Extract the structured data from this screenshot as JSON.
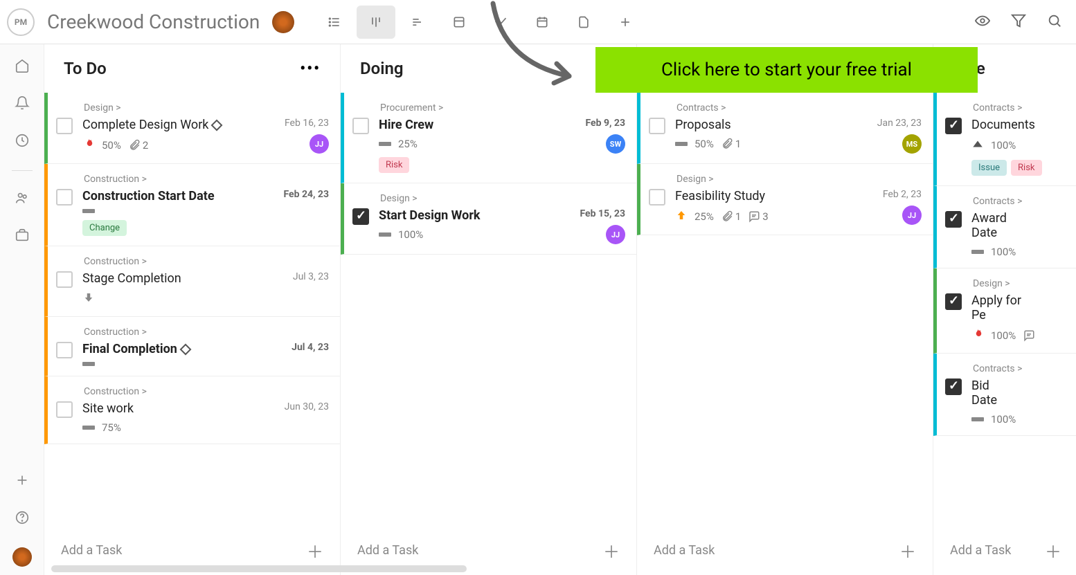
{
  "logo_text": "PM",
  "project": "Creekwood Construction",
  "cta": "Click here to start your free trial",
  "add_task_label": "Add a Task",
  "columns": [
    {
      "title": "To Do",
      "show_menu": true,
      "cards": [
        {
          "breadcrumb": "Design >",
          "title": "Complete Design Work",
          "bold": false,
          "milestone": true,
          "date": "Feb 16, 23",
          "date_bold": false,
          "color": "green",
          "checked": false,
          "meta": [
            {
              "type": "flame"
            },
            {
              "type": "text",
              "val": "50%"
            },
            {
              "type": "attach",
              "val": "2"
            }
          ],
          "tags": [],
          "assignee": {
            "cls": "jj",
            "txt": "JJ"
          }
        },
        {
          "breadcrumb": "Construction >",
          "title": "Construction Start Date",
          "bold": true,
          "milestone": false,
          "date": "Feb 24, 23",
          "date_bold": true,
          "color": "orange",
          "checked": false,
          "meta": [
            {
              "type": "bar"
            }
          ],
          "tags": [
            "change"
          ],
          "assignee": null
        },
        {
          "breadcrumb": "Construction >",
          "title": "Stage Completion",
          "bold": false,
          "milestone": false,
          "date": "Jul 3, 23",
          "date_bold": false,
          "color": "orange",
          "checked": false,
          "meta": [
            {
              "type": "arrow-down"
            }
          ],
          "tags": [],
          "assignee": null
        },
        {
          "breadcrumb": "Construction >",
          "title": "Final Completion",
          "bold": true,
          "milestone": true,
          "date": "Jul 4, 23",
          "date_bold": true,
          "color": "orange",
          "checked": false,
          "meta": [
            {
              "type": "bar"
            }
          ],
          "tags": [],
          "assignee": null
        },
        {
          "breadcrumb": "Construction >",
          "title": "Site work",
          "bold": false,
          "milestone": false,
          "date": "Jun 30, 23",
          "date_bold": false,
          "color": "orange",
          "checked": false,
          "meta": [
            {
              "type": "bar"
            },
            {
              "type": "text",
              "val": "75%"
            }
          ],
          "tags": [],
          "assignee": null
        }
      ]
    },
    {
      "title": "Doing",
      "show_menu": false,
      "cards": [
        {
          "breadcrumb": "Procurement >",
          "title": "Hire Crew",
          "bold": true,
          "milestone": false,
          "date": "Feb 9, 23",
          "date_bold": true,
          "color": "cyan",
          "checked": false,
          "meta": [
            {
              "type": "bar"
            },
            {
              "type": "text",
              "val": "25%"
            }
          ],
          "tags": [
            "risk"
          ],
          "assignee": {
            "cls": "sw",
            "txt": "SW"
          }
        },
        {
          "breadcrumb": "Design >",
          "title": "Start Design Work",
          "bold": true,
          "milestone": false,
          "date": "Feb 15, 23",
          "date_bold": true,
          "color": "green",
          "checked": true,
          "meta": [
            {
              "type": "bar"
            },
            {
              "type": "text",
              "val": "100%"
            }
          ],
          "tags": [],
          "assignee": {
            "cls": "jj",
            "txt": "JJ"
          }
        }
      ]
    },
    {
      "title": "",
      "show_menu": false,
      "cards": [
        {
          "breadcrumb": "Contracts >",
          "title": "Proposals",
          "bold": false,
          "milestone": false,
          "date": "Jan 23, 23",
          "date_bold": false,
          "color": "cyan",
          "checked": false,
          "meta": [
            {
              "type": "bar"
            },
            {
              "type": "text",
              "val": "50%"
            },
            {
              "type": "attach",
              "val": "1"
            }
          ],
          "tags": [],
          "assignee": {
            "cls": "ms",
            "txt": "MS"
          }
        },
        {
          "breadcrumb": "Design >",
          "title": "Feasibility Study",
          "bold": false,
          "milestone": false,
          "date": "Feb 2, 23",
          "date_bold": false,
          "color": "green",
          "checked": false,
          "meta": [
            {
              "type": "arrow-up-orange"
            },
            {
              "type": "text",
              "val": "25%"
            },
            {
              "type": "attach",
              "val": "1"
            },
            {
              "type": "comment",
              "val": "3"
            }
          ],
          "tags": [],
          "assignee": {
            "cls": "jj",
            "txt": "JJ"
          }
        }
      ]
    },
    {
      "title": "...ne",
      "show_menu": false,
      "partial": true,
      "cards": [
        {
          "breadcrumb": "Contracts >",
          "title": "Documents",
          "bold": false,
          "milestone": false,
          "date": "",
          "date_bold": false,
          "color": "cyan",
          "checked": true,
          "meta": [
            {
              "type": "arrow-up-dark"
            },
            {
              "type": "text",
              "val": "100%"
            }
          ],
          "tags": [
            "issue",
            "risk"
          ],
          "assignee": null
        },
        {
          "breadcrumb": "Contracts >",
          "title": "Award Date",
          "bold": false,
          "milestone": false,
          "date": "",
          "date_bold": false,
          "color": "cyan",
          "checked": true,
          "meta": [
            {
              "type": "bar"
            },
            {
              "type": "text",
              "val": "100%"
            }
          ],
          "tags": [],
          "assignee": null
        },
        {
          "breadcrumb": "Design >",
          "title": "Apply for Pe",
          "bold": false,
          "milestone": false,
          "date": "",
          "date_bold": false,
          "color": "green",
          "checked": true,
          "meta": [
            {
              "type": "flame"
            },
            {
              "type": "text",
              "val": "100%"
            },
            {
              "type": "comment",
              "val": ""
            }
          ],
          "tags": [],
          "assignee": null
        },
        {
          "breadcrumb": "Contracts >",
          "title": "Bid Date",
          "bold": false,
          "milestone": false,
          "date": "",
          "date_bold": false,
          "color": "cyan",
          "checked": true,
          "meta": [
            {
              "type": "bar"
            },
            {
              "type": "text",
              "val": "100%"
            }
          ],
          "tags": [],
          "assignee": null
        }
      ]
    }
  ]
}
